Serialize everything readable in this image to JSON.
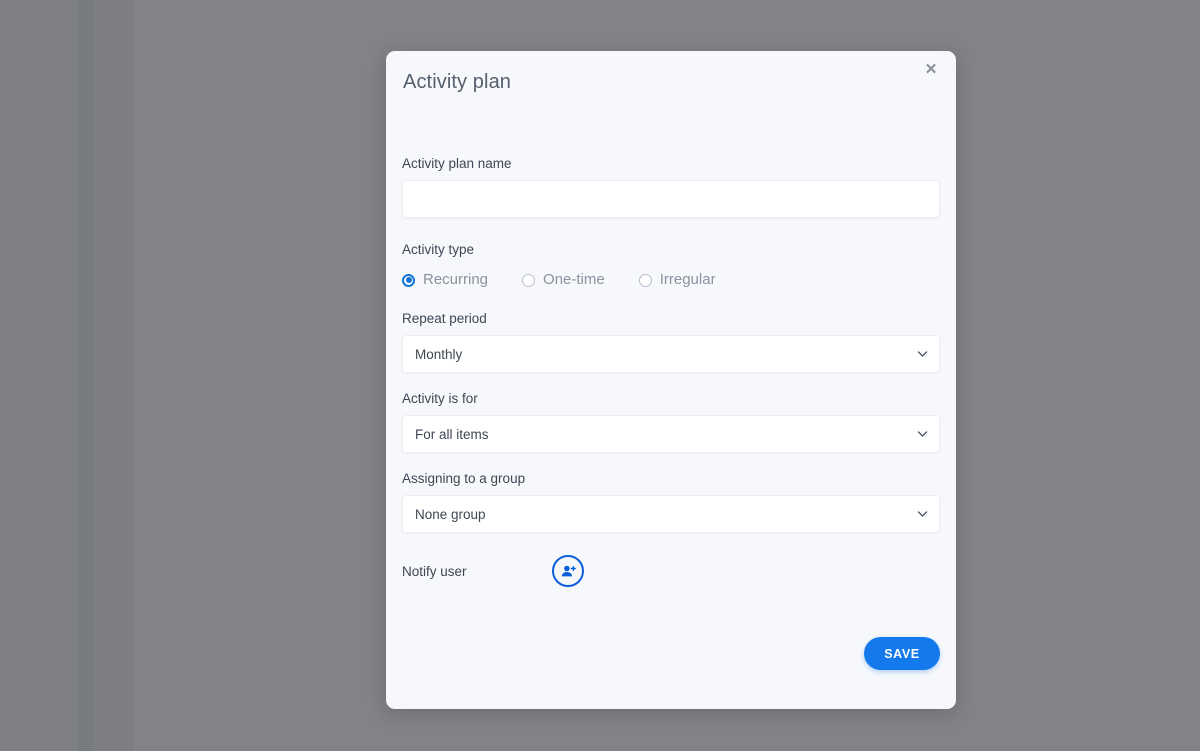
{
  "modal": {
    "title": "Activity plan",
    "close_label": "✕",
    "fields": {
      "activity_plan_name": {
        "label": "Activity plan name",
        "value": "",
        "placeholder": ""
      },
      "activity_type": {
        "label": "Activity type",
        "options": [
          {
            "label": "Recurring",
            "selected": true
          },
          {
            "label": "One-time",
            "selected": false
          },
          {
            "label": "Irregular",
            "selected": false
          }
        ]
      },
      "repeat_period": {
        "label": "Repeat period",
        "value": "Monthly"
      },
      "activity_is_for": {
        "label": "Activity is for",
        "value": "For all items"
      },
      "assigning_to_a_group": {
        "label": "Assigning to a group",
        "value": "None group"
      },
      "notify_user": {
        "label": "Notify user",
        "icon": "add-user-icon"
      }
    },
    "actions": {
      "save_label": "SAVE"
    }
  },
  "colors": {
    "accent": "#1479ec",
    "accent_dark": "#0b5ed9",
    "modal_bg": "#f6f8fc",
    "backdrop": "#7f8084",
    "title_text": "#55606e",
    "label_text": "#3e4754",
    "radio_label_text": "#8a939f"
  }
}
